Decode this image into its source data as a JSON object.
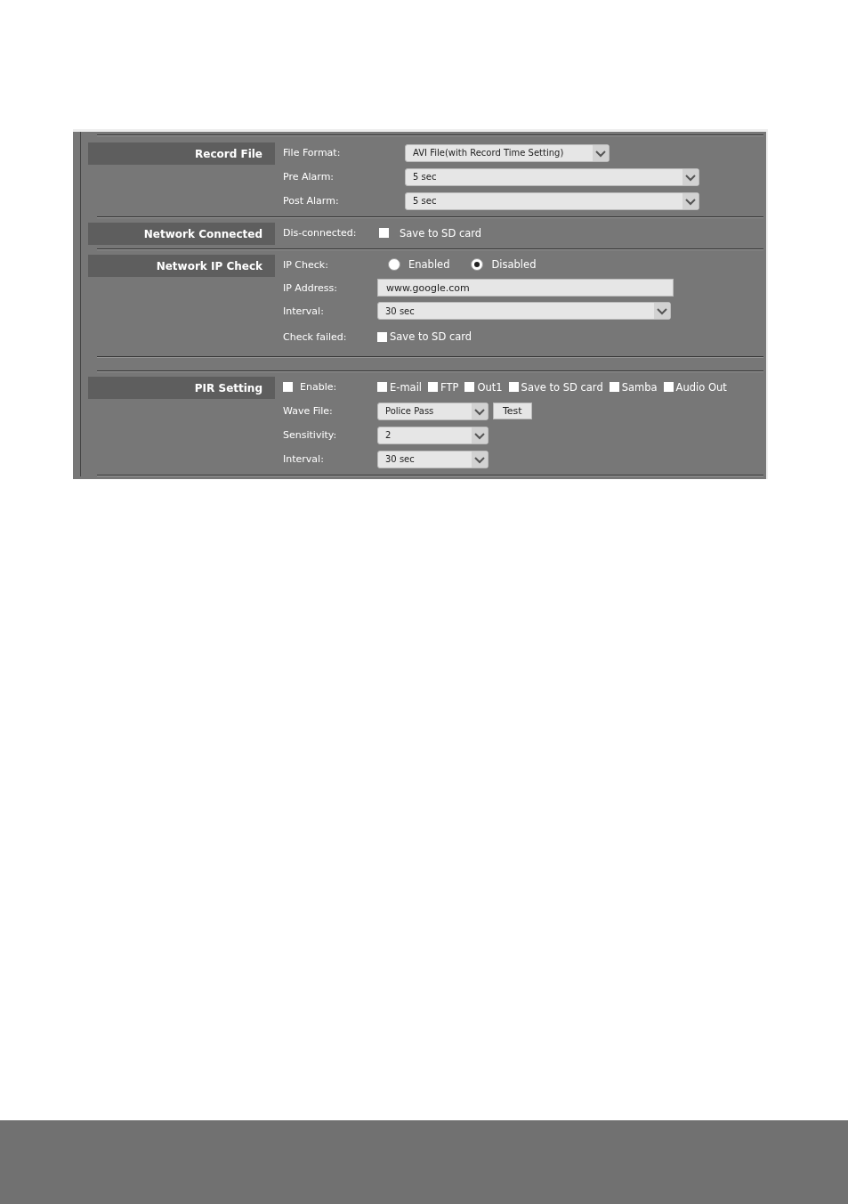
{
  "sections": [
    {
      "title": "Record File",
      "rows": [
        {
          "label": "File Format:",
          "kind": "select",
          "value": "AVI File(with Record Time Setting)"
        },
        {
          "label": "Pre Alarm:",
          "kind": "select",
          "value": "5 sec"
        },
        {
          "label": "Post Alarm:",
          "kind": "select",
          "value": "5 sec"
        }
      ]
    },
    {
      "title": "Network Connected",
      "rows": [
        {
          "label": "Dis-connected:",
          "kind": "checks",
          "options": [
            {
              "label": "Save to SD card",
              "checked": false
            }
          ]
        }
      ]
    },
    {
      "title": "Network IP Check",
      "rows": [
        {
          "label": "IP Check:",
          "kind": "radio",
          "options": [
            {
              "label": "Enabled",
              "selected": false
            },
            {
              "label": "Disabled",
              "selected": true
            }
          ]
        },
        {
          "label": "IP Address:",
          "kind": "input",
          "value": "www.google.com"
        },
        {
          "label": "Interval:",
          "kind": "select",
          "value": "30 sec"
        },
        {
          "label": "Check failed:",
          "kind": "checks",
          "options": [
            {
              "label": "Save to SD card",
              "checked": false
            }
          ]
        }
      ]
    },
    {
      "title": "PIR Setting",
      "rows": [
        {
          "label": "Enable:",
          "label_checked": false,
          "kind": "checks",
          "options": [
            {
              "label": "E-mail",
              "checked": false
            },
            {
              "label": "FTP",
              "checked": false
            },
            {
              "label": "Out1",
              "checked": false
            },
            {
              "label": "Save to SD card",
              "checked": false
            },
            {
              "label": "Samba",
              "checked": false
            },
            {
              "label": "Audio Out",
              "checked": false
            }
          ]
        },
        {
          "label": "Wave File:",
          "kind": "select",
          "value": "Police Pass",
          "button": "Test"
        },
        {
          "label": "Sensitivity:",
          "kind": "select",
          "value": "2"
        },
        {
          "label": "Interval:",
          "kind": "select",
          "value": "30 sec"
        }
      ]
    }
  ]
}
